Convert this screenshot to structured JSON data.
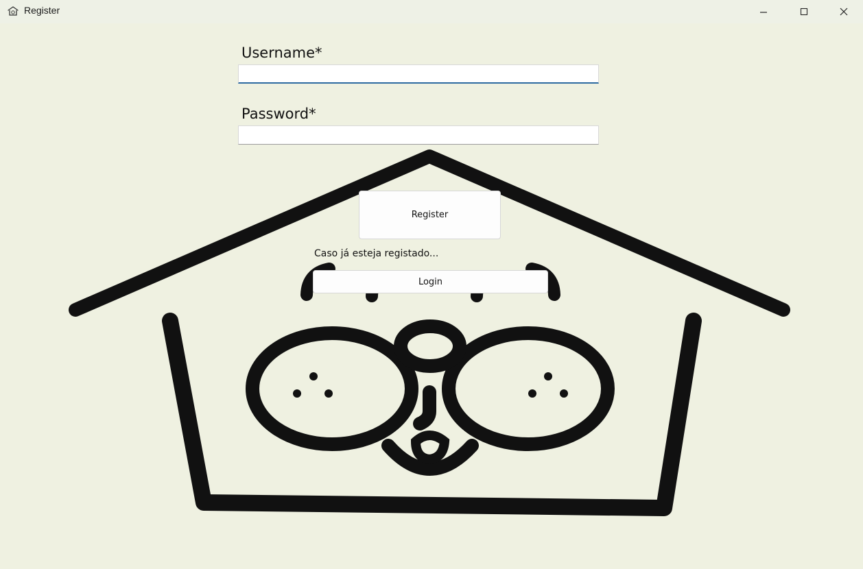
{
  "window": {
    "title": "Register",
    "icon": "dog-house-icon",
    "controls": [
      "minimize-icon",
      "maximize-icon",
      "close-icon"
    ]
  },
  "form": {
    "username_label": "Username*",
    "username_value": "",
    "password_label": "Password*",
    "password_value": "",
    "register_label": "Register",
    "login_hint": "Caso já esteja registado...",
    "login_label": "Login"
  },
  "background": {
    "image": "dog-house-logo",
    "color": "#eff1e1",
    "ink_color": "#111111"
  }
}
